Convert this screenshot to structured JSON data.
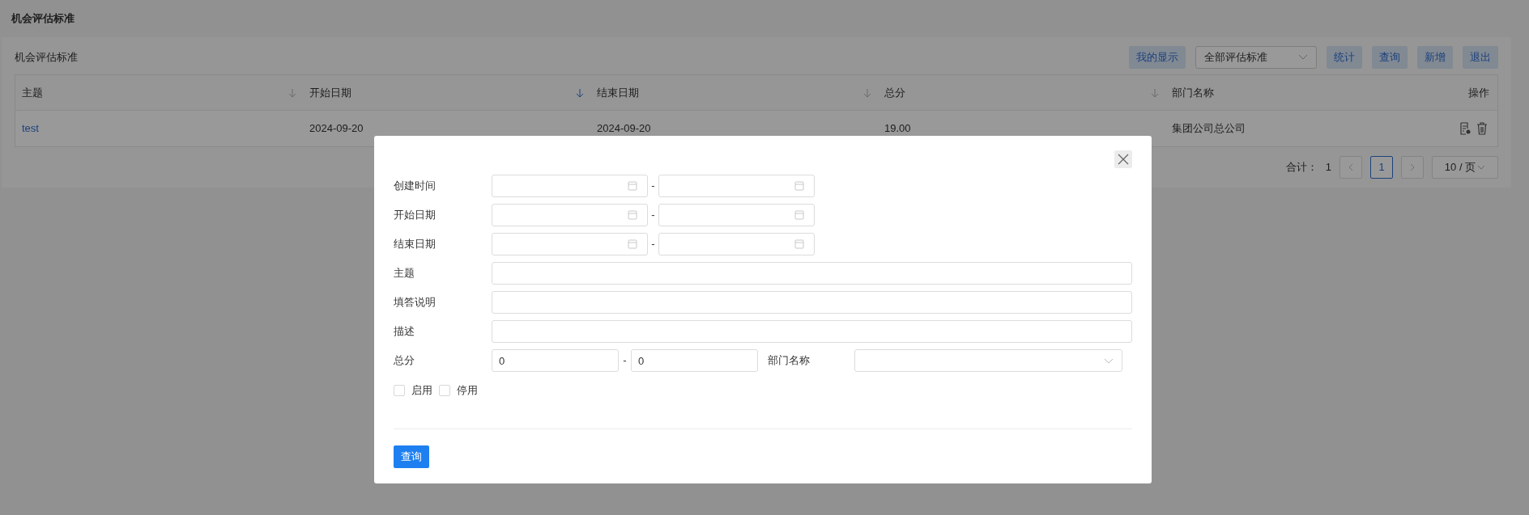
{
  "page_title": "机会评估标准",
  "panel": {
    "title": "机会评估标准",
    "toolbar": [
      {
        "kind": "button",
        "label": "我的显示"
      },
      {
        "kind": "select",
        "label": "全部评估标准"
      },
      {
        "kind": "button",
        "label": "统计"
      },
      {
        "kind": "button",
        "label": "查询"
      },
      {
        "kind": "button",
        "label": "新增"
      },
      {
        "kind": "button",
        "label": "退出"
      }
    ],
    "table": {
      "columns": [
        {
          "label": "主题",
          "sortable": true,
          "sorted": false
        },
        {
          "label": "开始日期",
          "sortable": true,
          "sorted": true
        },
        {
          "label": "结束日期",
          "sortable": true,
          "sorted": false
        },
        {
          "label": "总分",
          "sortable": true,
          "sorted": false
        },
        {
          "label": "部门名称",
          "sortable": false
        },
        {
          "label": "操作",
          "sortable": false
        }
      ],
      "rows": [
        {
          "cells": [
            "test",
            "2024-09-20",
            "2024-09-20",
            "19.00",
            "集团公司总公司"
          ]
        }
      ]
    },
    "pagination": {
      "total_label": "合计：",
      "total": "1",
      "pages": [
        {
          "label": "1",
          "selected": true
        }
      ],
      "page_size": "10 / 页"
    }
  },
  "modal": {
    "date_ranges": [
      {
        "label": "创建时间",
        "separator": "-"
      },
      {
        "label": "开始日期",
        "separator": "-"
      },
      {
        "label": "结束日期",
        "separator": "-"
      }
    ],
    "text_fields": [
      {
        "label": "主题"
      },
      {
        "label": "填答说明"
      },
      {
        "label": "描述"
      }
    ],
    "score": {
      "label": "总分",
      "min": "0",
      "separator": "-",
      "max": "0"
    },
    "department": {
      "label": "部门名称"
    },
    "checkboxes": [
      {
        "label": "启用",
        "checked": false
      },
      {
        "label": "停用",
        "checked": false
      }
    ],
    "submit": "查询"
  }
}
